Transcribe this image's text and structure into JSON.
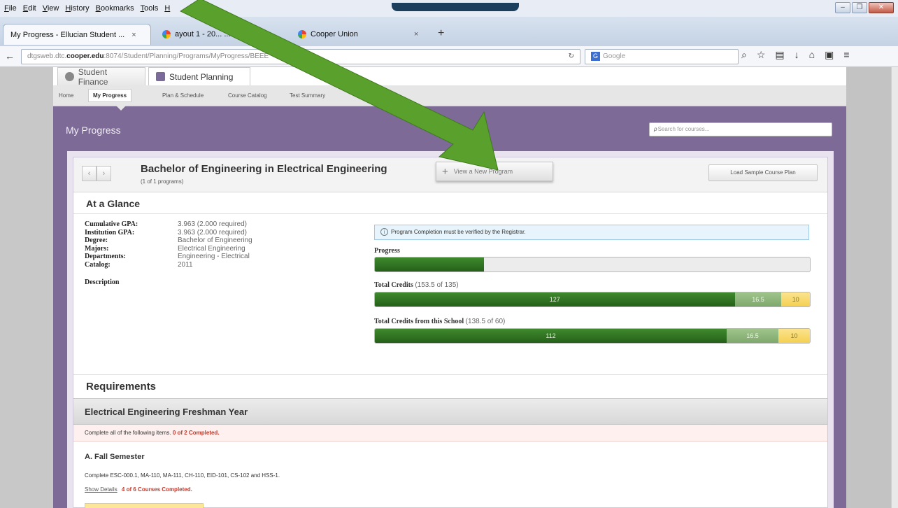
{
  "browser": {
    "menu": [
      "File",
      "Edit",
      "View",
      "History",
      "Bookmarks",
      "Tools",
      "H"
    ],
    "tabs": [
      {
        "label": "My Progress - Ellucian Student ...",
        "close": "×"
      },
      {
        "label": "ayout 1 - 20...  ...ndf",
        "close": "×"
      },
      {
        "label": "Cooper Union",
        "close": "×"
      }
    ],
    "new_tab": "+",
    "back": "←",
    "url_prefix": "dtgsweb.dtc.",
    "url_domain": "cooper.edu",
    "url_rest": ":8074/Student/Planning/Programs/MyProgress/BEEE",
    "reload": "↻",
    "search_engine_glyph": "G",
    "search_placeholder": "Google"
  },
  "modules": {
    "student_finance": "Student Finance",
    "student_planning": "Student Planning"
  },
  "subnav": {
    "home": "Home",
    "my_progress": "My Progress",
    "plan_schedule": "Plan & Schedule",
    "course_catalog": "Course Catalog",
    "test_summary": "Test Summary"
  },
  "page": {
    "title": "My Progress",
    "search_placeholder": "Search for courses..."
  },
  "program": {
    "prev": "‹",
    "next": "›",
    "title": "Bachelor of Engineering in Electrical Engineering",
    "count": "(1 of 1 programs)",
    "view_new_plus": "+",
    "view_new_label": "View a New Program",
    "load_sample": "Load Sample Course Plan"
  },
  "glance": {
    "heading": "At a Glance",
    "fields": [
      {
        "key": "Cumulative GPA:",
        "value": "3.963 (2.000 required)"
      },
      {
        "key": "Institution GPA:",
        "value": "3.963 (2.000 required)"
      },
      {
        "key": "Degree:",
        "value": "Bachelor of Engineering"
      },
      {
        "key": "Majors:",
        "value": "Electrical Engineering"
      },
      {
        "key": "Departments:",
        "value": "Engineering - Electrical"
      },
      {
        "key": "Catalog:",
        "value": "2011"
      }
    ],
    "description_label": "Description",
    "notice": "Program Completion must be verified by the Registrar.",
    "notice_icon": "i",
    "progress_label": "Progress",
    "progress_fraction": 0.25,
    "total_credits_label": "Total Credits",
    "total_credits_paren": "(153.5 of 135)",
    "total_credits": {
      "completed": 127,
      "in_progress": 16.5,
      "planned": 10,
      "completed_label": "127",
      "in_progress_label": "16.5",
      "planned_label": "10"
    },
    "school_credits_label": "Total Credits from this School",
    "school_credits_paren": "(138.5 of 60)",
    "school_credits": {
      "completed": 112,
      "in_progress": 16.5,
      "planned": 10,
      "completed_label": "112",
      "in_progress_label": "16.5",
      "planned_label": "10"
    }
  },
  "requirements": {
    "heading": "Requirements",
    "year": "Electrical Engineering Freshman Year",
    "complete_text": "Complete all of the following items.",
    "complete_status": "0 of 2 Completed.",
    "fall_heading": "A.  Fall Semester",
    "fall_desc": "Complete ESC-000.1, MA-110, MA-111, CH-110, EID-101, CS-102 and HSS-1.",
    "show_details": "Show Details",
    "fall_status": "4 of 6 Courses Completed."
  },
  "colors": {
    "purple": "#7d6a96",
    "completed": "#2f7523",
    "in_progress": "#8fb77b",
    "planned": "#f4cf51",
    "arrow": "#5aa02c",
    "status_red": "#c0392b"
  }
}
